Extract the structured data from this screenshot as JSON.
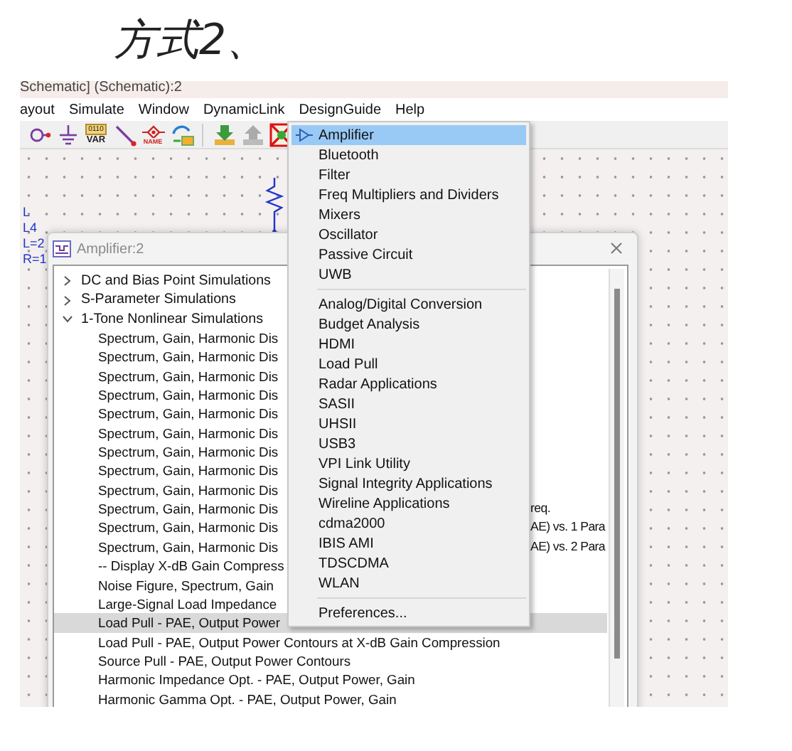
{
  "annotation": "方式2、",
  "window": {
    "title": "Schematic] (Schematic):2"
  },
  "menubar": [
    "ayout",
    "Simulate",
    "Window",
    "DynamicLink",
    "DesignGuide",
    "Help"
  ],
  "toolbar": [
    {
      "kind": "port"
    },
    {
      "kind": "ground"
    },
    {
      "kind": "var",
      "code": "0110",
      "label": "VAR"
    },
    {
      "kind": "wire"
    },
    {
      "kind": "name",
      "label": "NAME"
    },
    {
      "kind": "swap"
    },
    {
      "kind": "separator"
    },
    {
      "kind": "download"
    },
    {
      "kind": "upload"
    },
    {
      "kind": "cross"
    }
  ],
  "canvas": {
    "labels": [
      "L",
      "L4",
      "L=2",
      "R=1"
    ]
  },
  "dropdown": {
    "items": [
      {
        "kind": "item",
        "label": "Amplifier",
        "selected": true,
        "icon": true
      },
      {
        "kind": "item",
        "label": "Bluetooth",
        "selected": false
      },
      {
        "kind": "item",
        "label": "Filter",
        "selected": false
      },
      {
        "kind": "item",
        "label": "Freq Multipliers and Dividers",
        "selected": false
      },
      {
        "kind": "item",
        "label": "Mixers",
        "selected": false
      },
      {
        "kind": "item",
        "label": "Oscillator",
        "selected": false
      },
      {
        "kind": "item",
        "label": "Passive Circuit",
        "selected": false
      },
      {
        "kind": "item",
        "label": "UWB",
        "selected": false
      },
      {
        "kind": "separator"
      },
      {
        "kind": "item",
        "label": "Analog/Digital Conversion",
        "selected": false
      },
      {
        "kind": "item",
        "label": "Budget Analysis",
        "selected": false
      },
      {
        "kind": "item",
        "label": "HDMI",
        "selected": false
      },
      {
        "kind": "item",
        "label": "Load Pull",
        "selected": false
      },
      {
        "kind": "item",
        "label": "Radar Applications",
        "selected": false
      },
      {
        "kind": "item",
        "label": "SASII",
        "selected": false
      },
      {
        "kind": "item",
        "label": "UHSII",
        "selected": false
      },
      {
        "kind": "item",
        "label": "USB3",
        "selected": false
      },
      {
        "kind": "item",
        "label": "VPI Link Utility",
        "selected": false
      },
      {
        "kind": "item",
        "label": "Signal Integrity Applications",
        "selected": false
      },
      {
        "kind": "item",
        "label": "Wireline Applications",
        "selected": false
      },
      {
        "kind": "item",
        "label": "cdma2000",
        "selected": false
      },
      {
        "kind": "item",
        "label": "IBIS AMI",
        "selected": false
      },
      {
        "kind": "item",
        "label": "TDSCDMA",
        "selected": false
      },
      {
        "kind": "item",
        "label": "WLAN",
        "selected": false
      },
      {
        "kind": "separator"
      },
      {
        "kind": "item",
        "label": "Preferences...",
        "selected": false
      }
    ]
  },
  "dialog": {
    "title": "Amplifier:2",
    "tree": [
      {
        "label": "DC and Bias Point Simulations",
        "expanded": false
      },
      {
        "label": "S-Parameter Simulations",
        "expanded": false
      },
      {
        "label": "1-Tone Nonlinear Simulations",
        "expanded": true,
        "children": [
          {
            "label": "Spectrum, Gain, Harmonic Dis",
            "selected": false
          },
          {
            "label": "Spectrum, Gain, Harmonic Dis",
            "selected": false
          },
          {
            "label": "Spectrum, Gain, Harmonic Dis",
            "selected": false
          },
          {
            "label": "Spectrum, Gain, Harmonic Dis",
            "selected": false
          },
          {
            "label": "Spectrum, Gain, Harmonic Dis",
            "selected": false
          },
          {
            "label": "Spectrum, Gain, Harmonic Dis",
            "selected": false
          },
          {
            "label": "Spectrum, Gain, Harmonic Dis",
            "selected": false
          },
          {
            "label": "Spectrum, Gain, Harmonic Dis",
            "selected": false
          },
          {
            "label": "Spectrum, Gain, Harmonic Dis",
            "selected": false
          },
          {
            "label": "Spectrum, Gain, Harmonic Dis",
            "selected": false,
            "tail": "req."
          },
          {
            "label": "Spectrum, Gain, Harmonic Dis",
            "selected": false,
            "tail": "AE) vs. 1 Para"
          },
          {
            "label": "Spectrum, Gain, Harmonic Dis",
            "selected": false,
            "tail": "AE) vs. 2 Para"
          },
          {
            "label": "-- Display X-dB Gain Compress",
            "selected": false
          },
          {
            "label": "Noise Figure, Spectrum, Gain",
            "selected": false
          },
          {
            "label": "Large-Signal Load Impedance",
            "selected": false
          },
          {
            "label": "Load Pull - PAE, Output Power",
            "selected": true
          },
          {
            "label": "Load Pull - PAE, Output Power Contours at X-dB Gain Compression",
            "selected": false
          },
          {
            "label": "Source Pull - PAE, Output Power Contours",
            "selected": false
          },
          {
            "label": "Harmonic Impedance Opt. - PAE, Output Power, Gain",
            "selected": false
          },
          {
            "label": "Harmonic Gamma Opt. - PAE, Output Power, Gain",
            "selected": false
          }
        ]
      }
    ]
  }
}
